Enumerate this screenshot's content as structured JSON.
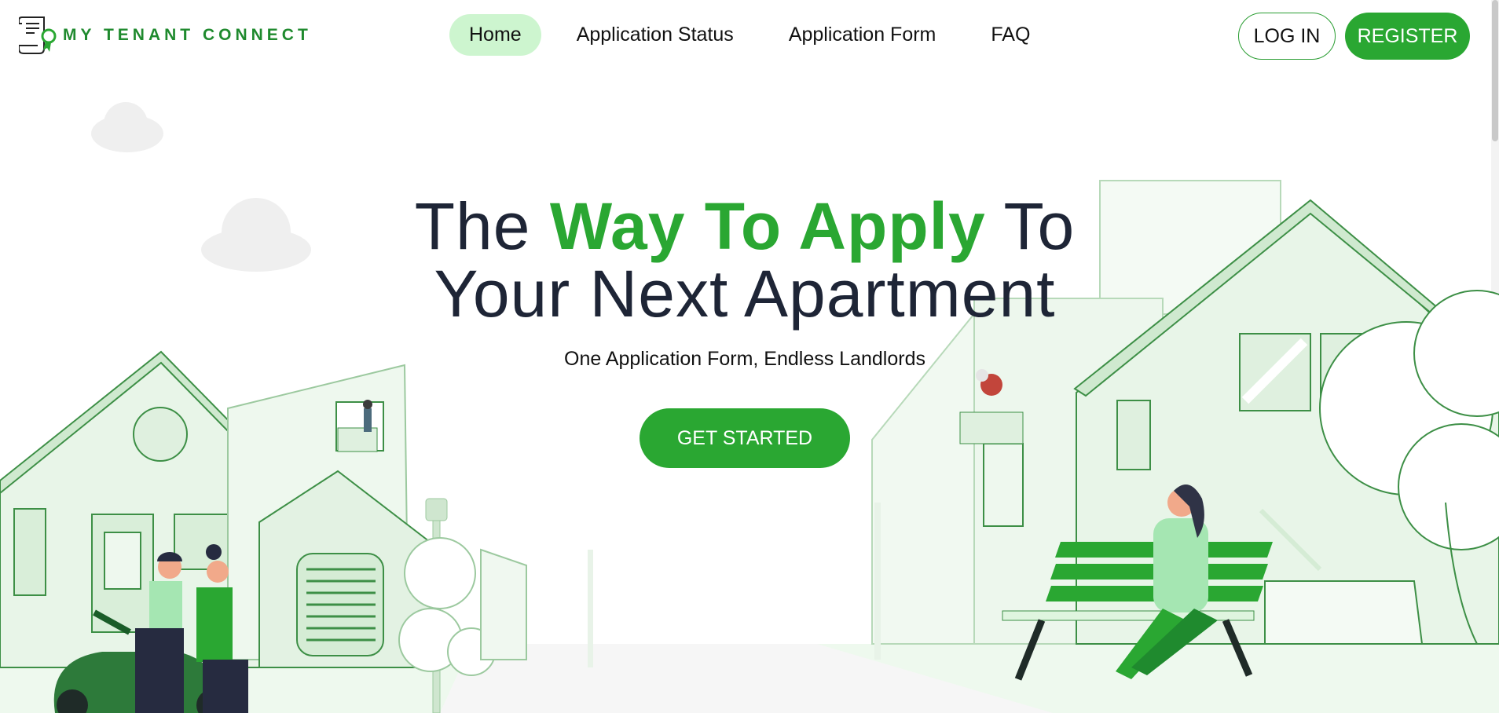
{
  "brand": {
    "name": "MY TENANT CONNECT",
    "color": "#1f8a2e",
    "logo_icon": "certificate-scroll-icon"
  },
  "nav": {
    "items": [
      {
        "label": "Home",
        "active": true
      },
      {
        "label": "Application Status",
        "active": false
      },
      {
        "label": "Application Form",
        "active": false
      },
      {
        "label": "FAQ",
        "active": false
      }
    ],
    "login_label": "LOG IN",
    "register_label": "REGISTER"
  },
  "hero": {
    "title_pre": "The ",
    "title_accent": "Way To Apply",
    "title_post": " To",
    "title_line2": "Your Next Apartment",
    "subtitle": "One Application Form, Endless Landlords",
    "cta_label": "GET STARTED"
  },
  "colors": {
    "accent": "#2aa732",
    "accent_light": "#cdf5cf",
    "text_dark": "#1e2536"
  }
}
